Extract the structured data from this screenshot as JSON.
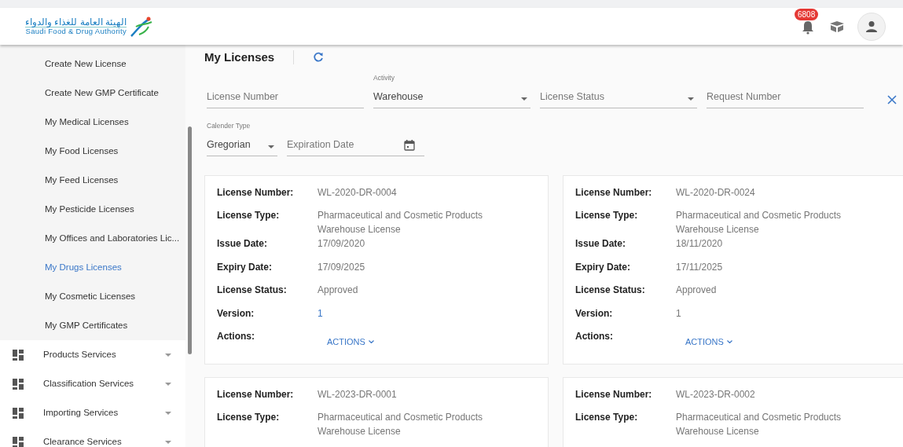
{
  "header": {
    "logo": {
      "arabic": "الهيئة العامة للغذاء والدواء",
      "english": "Saudi Food & Drug Authority"
    },
    "notifications": {
      "count": "6808"
    }
  },
  "sidebar": {
    "items": [
      {
        "kind": "link",
        "label": "Create New License",
        "selected": false
      },
      {
        "kind": "link",
        "label": "Create New GMP Certificate",
        "selected": false
      },
      {
        "kind": "link",
        "label": "My Medical Licenses",
        "selected": false
      },
      {
        "kind": "link",
        "label": "My Food Licenses",
        "selected": false
      },
      {
        "kind": "link",
        "label": "My Feed Licenses",
        "selected": false
      },
      {
        "kind": "link",
        "label": "My Pesticide Licenses",
        "selected": false
      },
      {
        "kind": "link",
        "label": "My Offices and Laboratories Lic...",
        "selected": false
      },
      {
        "kind": "link",
        "label": "My Drugs Licenses",
        "selected": true
      },
      {
        "kind": "link",
        "label": "My Cosmetic Licenses",
        "selected": false
      },
      {
        "kind": "link",
        "label": "My GMP Certificates",
        "selected": false
      },
      {
        "kind": "group",
        "label": "Products Services",
        "expanded": false
      },
      {
        "kind": "group",
        "label": "Classification Services",
        "expanded": false
      },
      {
        "kind": "group",
        "label": "Importing Services",
        "expanded": false
      },
      {
        "kind": "group",
        "label": "Clearance Services",
        "expanded": false
      }
    ]
  },
  "page": {
    "title": "My Licenses"
  },
  "filters": [
    {
      "kind": "text",
      "placeholder": "License Number"
    },
    {
      "kind": "select",
      "label": "Activity",
      "value": "Warehouse"
    },
    {
      "kind": "select",
      "placeholder": "License Status"
    },
    {
      "kind": "text",
      "placeholder": "Request Number"
    },
    {
      "kind": "select",
      "label": "Calender Type",
      "value": "Gregorian"
    },
    {
      "kind": "date",
      "placeholder": "Expiration Date"
    }
  ],
  "licenses": [
    {
      "fields": [
        {
          "label": "License Number:",
          "value": "WL-2020-DR-0004"
        },
        {
          "label": "License Type:",
          "value": "Pharmaceutical and Cosmetic Products Warehouse License"
        },
        {
          "label": "Issue Date:",
          "value": "17/09/2020"
        },
        {
          "label": "Expiry Date:",
          "value": "17/09/2025"
        },
        {
          "label": "License Status:",
          "value": "Approved"
        },
        {
          "label": "Version:",
          "value": "1",
          "kind": "link"
        }
      ],
      "actions_label": "Actions:",
      "actions_button": "ACTIONS"
    },
    {
      "fields": [
        {
          "label": "License Number:",
          "value": "WL-2020-DR-0024"
        },
        {
          "label": "License Type:",
          "value": "Pharmaceutical and Cosmetic Products Warehouse License"
        },
        {
          "label": "Issue Date:",
          "value": "18/11/2020"
        },
        {
          "label": "Expiry Date:",
          "value": "17/11/2025"
        },
        {
          "label": "License Status:",
          "value": "Approved"
        },
        {
          "label": "Version:",
          "value": "1"
        }
      ],
      "actions_label": "Actions:",
      "actions_button": "ACTIONS"
    },
    {
      "fields": [
        {
          "label": "License Number:",
          "value": "WL-2023-DR-0001"
        },
        {
          "label": "License Type:",
          "value": "Pharmaceutical and Cosmetic Products Warehouse License"
        }
      ]
    },
    {
      "fields": [
        {
          "label": "License Number:",
          "value": "WL-2023-DR-0002"
        },
        {
          "label": "License Type:",
          "value": "Pharmaceutical and Cosmetic Products Warehouse License"
        }
      ]
    }
  ]
}
